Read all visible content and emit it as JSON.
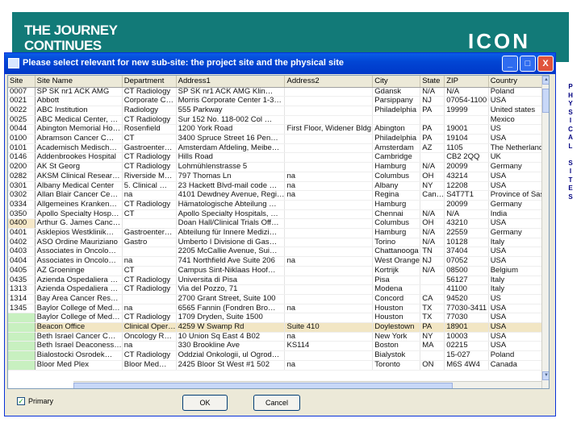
{
  "slide": {
    "heading_line1": "THE JOURNEY",
    "heading_line2": "CONTINUES",
    "logo": "ICON"
  },
  "window": {
    "title": "Please select relevant for new sub-site: the project site and the physical site",
    "min_label": "_",
    "max_label": "□",
    "close_label": "X"
  },
  "table": {
    "headers": [
      "Site",
      "Site Name",
      "Department",
      "Address1",
      "Address2",
      "City",
      "State",
      "ZIP",
      "Country"
    ],
    "rows": [
      [
        "0007",
        "SP SK nr1 ACK AMG",
        "CT Radiology",
        "SP SK nr1 ACK AMG Klin…",
        "",
        "Gdansk",
        "N/A",
        "N/A",
        "Poland"
      ],
      [
        "0021",
        "Abbott",
        "Corporate C…",
        "Morris Corporate Center 1-3…",
        "",
        "Parsippany",
        "NJ",
        "07054-1100",
        "USA"
      ],
      [
        "0022",
        "ABC Institution",
        "Radiology",
        "555 Parkway",
        "",
        "Philadelphia",
        "PA",
        "19999",
        "United states"
      ],
      [
        "0025",
        "ABC Medical Center, …",
        "CT Radiology",
        "Sur 152 No. 118-002 Col …",
        "",
        "",
        "",
        "",
        "Mexico"
      ],
      [
        "0044",
        "Abington Memorial Ho…",
        "Rosenfield",
        "1200 York Road",
        "First Floor, Widener Bldg",
        "Abington",
        "PA",
        "19001",
        "US"
      ],
      [
        "0100",
        "Abramson Cancer C…",
        "CT",
        "3400 Spruce Street 16 Pen…",
        "",
        "Philadelphia",
        "PA",
        "19104",
        "USA"
      ],
      [
        "0101",
        "Academisch Medisch…",
        "Gastroenter…",
        "Amsterdam Afdeling, Meibe…",
        "",
        "Amsterdam",
        "AZ",
        "1105",
        "The Netherlands"
      ],
      [
        "0146",
        "Addenbrookes Hospital",
        "CT Radiology",
        "Hills Road",
        "",
        "Cambridge",
        "",
        "CB2 2QQ",
        "UK"
      ],
      [
        "0200",
        "AK St Georg",
        "CT Radiology",
        "Lohmühlenstrasse 5",
        "",
        "Hamburg",
        "N/A",
        "20099",
        "Germany"
      ],
      [
        "0282",
        "AKSM Clinical Resear…",
        "Riverside M…",
        "797 Thomas Ln",
        "na",
        "Columbus",
        "OH",
        "43214",
        "USA"
      ],
      [
        "0301",
        "Albany Medical Center",
        "5. Clinical …",
        "23 Hackett Blvd-mail code …",
        "na",
        "Albany",
        "NY",
        "12208",
        "USA"
      ],
      [
        "0302",
        "Allan Blair Cancer Ce…",
        "na",
        "4101 Dewdney Avenue, Regi…",
        "na",
        "Regina",
        "Can…",
        "S4T7T1",
        "Province of Sask"
      ],
      [
        "0334",
        "Allgemeines Kranken…",
        "CT Radiology",
        "Hämatologische Abteilung …",
        "",
        "Hamburg",
        "",
        "20099",
        "Germany"
      ],
      [
        "0350",
        "Apollo Specialty Hosp…",
        "CT",
        "Apollo Specialty Hospitals, …",
        "",
        "Chennai",
        "N/A",
        "N/A",
        "India"
      ],
      [
        "0400",
        "Arthur G. James Canc…",
        "",
        "Doan Hall/Clinical Trials Off…",
        "",
        "Columbus",
        "OH",
        "43210",
        "USA"
      ],
      [
        "0401",
        "Asklepios Westklinik…",
        "Gastroenter…",
        "Abteilung für Innere Medizi…",
        "",
        "Hamburg",
        "N/A",
        "22559",
        "Germany"
      ],
      [
        "0402",
        "ASO Ordine Mauriziano",
        "Gastro",
        "Umberto I Divisione di Gas…",
        "",
        "Torino",
        "N/A",
        "10128",
        "Italy"
      ],
      [
        "0403",
        "Associates in Oncolo…",
        "",
        "2205 McCallie Avenue, Sui…",
        "",
        "Chattanooga",
        "TN",
        "37404",
        "USA"
      ],
      [
        "0404",
        "Associates in Oncolo…",
        "na",
        "741 Northfield Ave Suite 206",
        "na",
        "West Orange",
        "NJ",
        "07052",
        "USA"
      ],
      [
        "0405",
        "AZ Groeninge",
        "CT",
        "Campus Sint-Niklaas Hoof…",
        "",
        "Kortrijk",
        "N/A",
        "08500",
        "Belgium"
      ],
      [
        "0435",
        "Azienda Ospedaliera …",
        "CT Radiology",
        "Universita di Pisa",
        "",
        "Pisa",
        "",
        "56127",
        "Italy"
      ],
      [
        "1313",
        "Azienda Ospedaliera …",
        "CT Radiology",
        "Via del Pozzo, 71",
        "",
        "Modena",
        "",
        "41100",
        "Italy"
      ],
      [
        "1314",
        "Bay Area Cancer Res…",
        "",
        "2700 Grant Street, Suite 100",
        "",
        "Concord",
        "CA",
        "94520",
        "US"
      ],
      [
        "1345",
        "Baylor College of Med…",
        "na",
        "6565 Fannin (Fondren Bro…",
        "na",
        "Houston",
        "TX",
        "77030-3411",
        "USA"
      ],
      [
        "",
        "Baylor College of Med…",
        "CT Radiology",
        "1709 Dryden, Suite 1500",
        "",
        "Houston",
        "TX",
        "77030",
        "USA"
      ],
      [
        "",
        "Beacon Office",
        "Clinical Oper…",
        "4259 W Swamp Rd",
        "Suite 410",
        "Doylestown",
        "PA",
        "18901",
        "USA"
      ],
      [
        "",
        "Beth Israel Cancer C…",
        "Oncology R…",
        "10 Union Sq East 4 B02",
        "na",
        "New York",
        "NY",
        "10003",
        "USA"
      ],
      [
        "",
        "Beth Israel Deaconess…",
        "na",
        "330 Brookline Ave",
        "KS114",
        "Boston",
        "MA",
        "02215",
        "USA"
      ],
      [
        "",
        "Bialostocki Osrodek…",
        "CT Radiology",
        "Oddzial Onkologii, ul Ogrod…",
        "",
        "Bialystok",
        "",
        "15-027",
        "Poland"
      ],
      [
        "",
        "Bloor Med Plex",
        "Bloor Med…",
        "2425 Bloor St West #1 502",
        "na",
        "Toronto",
        "ON",
        "M6S 4W4",
        "Canada"
      ]
    ]
  },
  "footer": {
    "primary_label": "Primary",
    "primary_check": "✓",
    "ok_label": "OK",
    "cancel_label": "Cancel"
  },
  "side_label": [
    "P",
    "H",
    "Y",
    "S",
    "I",
    "C",
    "A",
    "L",
    "",
    "S",
    "I",
    "T",
    "E",
    "S"
  ]
}
